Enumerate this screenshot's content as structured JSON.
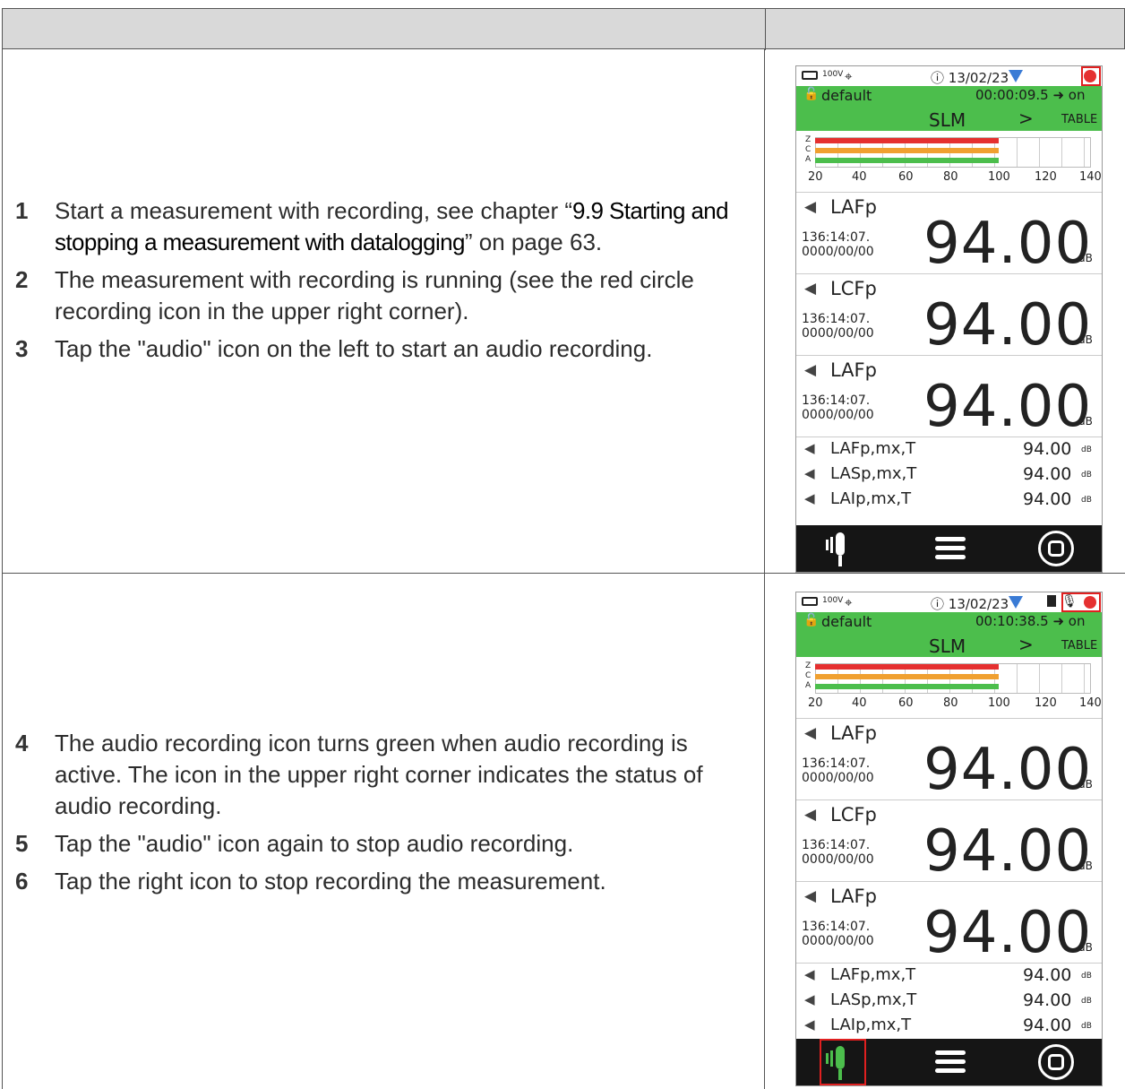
{
  "rows": [
    {
      "steps": [
        {
          "num": "1",
          "pre": "Start a measurement with recording, see chapter “",
          "link": "9.9 Starting and stopping a measurement with datalogging",
          "post": "” on page 63."
        },
        {
          "num": "2",
          "text": "The measurement with recording is running (see the red circle recording icon in the upper right corner)."
        },
        {
          "num": "3",
          "text": "Tap the \"audio\" icon on the left to start an audio recording."
        }
      ],
      "device": {
        "voltage": "100V",
        "date": "13/02/23",
        "preset": "default",
        "timer": "00:00:09.5",
        "mode_on": "on",
        "mode": "SLM",
        "chevron": ">",
        "table_label": "TABLE",
        "measurements": [
          {
            "name": "LAFp",
            "time": "136:14:07.",
            "date": "0000/00/00",
            "value": "94.00",
            "unit": "dB"
          },
          {
            "name": "LCFp",
            "time": "136:14:07.",
            "date": "0000/00/00",
            "value": "94.00",
            "unit": "dB"
          },
          {
            "name": "LAFp",
            "time": "136:14:07.",
            "date": "0000/00/00",
            "value": "94.00",
            "unit": "dB"
          }
        ],
        "mini": [
          {
            "name": "LAFp,mx,T",
            "value": "94.00",
            "unit": "dB"
          },
          {
            "name": "LASp,mx,T",
            "value": "94.00",
            "unit": "dB"
          },
          {
            "name": "LAIp,mx,T",
            "value": "94.00",
            "unit": "dB"
          }
        ],
        "mic_active": false
      }
    },
    {
      "steps": [
        {
          "num": "4",
          "text": "The audio recording icon turns green when audio recording is active. The icon in the upper right corner indicates the status of audio recording."
        },
        {
          "num": "5",
          "text": "Tap the \"audio\" icon again to stop audio recording."
        },
        {
          "num": "6",
          "text": "Tap the right icon to stop recording the measurement."
        }
      ],
      "device": {
        "voltage": "100V",
        "date": "13/02/23",
        "preset": "default",
        "timer": "00:10:38.5",
        "mode_on": "on",
        "mode": "SLM",
        "chevron": ">",
        "table_label": "TABLE",
        "measurements": [
          {
            "name": "LAFp",
            "time": "136:14:07.",
            "date": "0000/00/00",
            "value": "94.00",
            "unit": "dB"
          },
          {
            "name": "LCFp",
            "time": "136:14:07.",
            "date": "0000/00/00",
            "value": "94.00",
            "unit": "dB"
          },
          {
            "name": "LAFp",
            "time": "136:14:07.",
            "date": "0000/00/00",
            "value": "94.00",
            "unit": "dB"
          }
        ],
        "mini": [
          {
            "name": "LAFp,mx,T",
            "value": "94.00",
            "unit": "dB"
          },
          {
            "name": "LASp,mx,T",
            "value": "94.00",
            "unit": "dB"
          },
          {
            "name": "LAIp,mx,T",
            "value": "94.00",
            "unit": "dB"
          }
        ],
        "mic_active": true
      }
    }
  ],
  "bar_labels": [
    "Z",
    "C",
    "A"
  ],
  "bar_colors": [
    "#e53030",
    "#f0a030",
    "#4cbe4c"
  ],
  "bar_level_db": 100,
  "bar_scale": {
    "min": 20,
    "max": 140
  },
  "ticks": [
    "20",
    "40",
    "60",
    "80",
    "100",
    "120",
    "140"
  ],
  "colors": {
    "header_bg": "#d9d9d9",
    "green_band": "#4cbe4c",
    "record": "#e53030",
    "highlight": "#e02020"
  },
  "icons": [
    "battery-icon",
    "gps-icon",
    "alert-icon",
    "triangle-icon",
    "record-dot-icon",
    "lock-icon",
    "speaker-icon",
    "mic-icon",
    "menu-icon",
    "stop-icon",
    "sd-card-icon"
  ]
}
